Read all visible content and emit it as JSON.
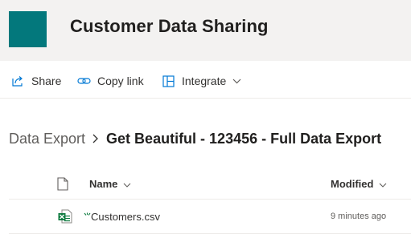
{
  "site": {
    "title": "Customer Data Sharing",
    "brand_color": "#03787c"
  },
  "commandbar": {
    "share_label": "Share",
    "share_icon": "share-icon",
    "copy_link_label": "Copy link",
    "copy_link_icon": "link-icon",
    "integrate_label": "Integrate",
    "integrate_icon": "integrate-icon"
  },
  "breadcrumb": {
    "parent": "Data Export",
    "current": "Get Beautiful - 123456 - Full Data Export"
  },
  "list": {
    "columns": {
      "type_icon": "document-icon",
      "name": "Name",
      "modified": "Modified"
    },
    "rows": [
      {
        "name": "Customers.csv",
        "modified": "9 minutes ago",
        "icon": "excel-csv-icon",
        "is_new": true
      }
    ]
  }
}
